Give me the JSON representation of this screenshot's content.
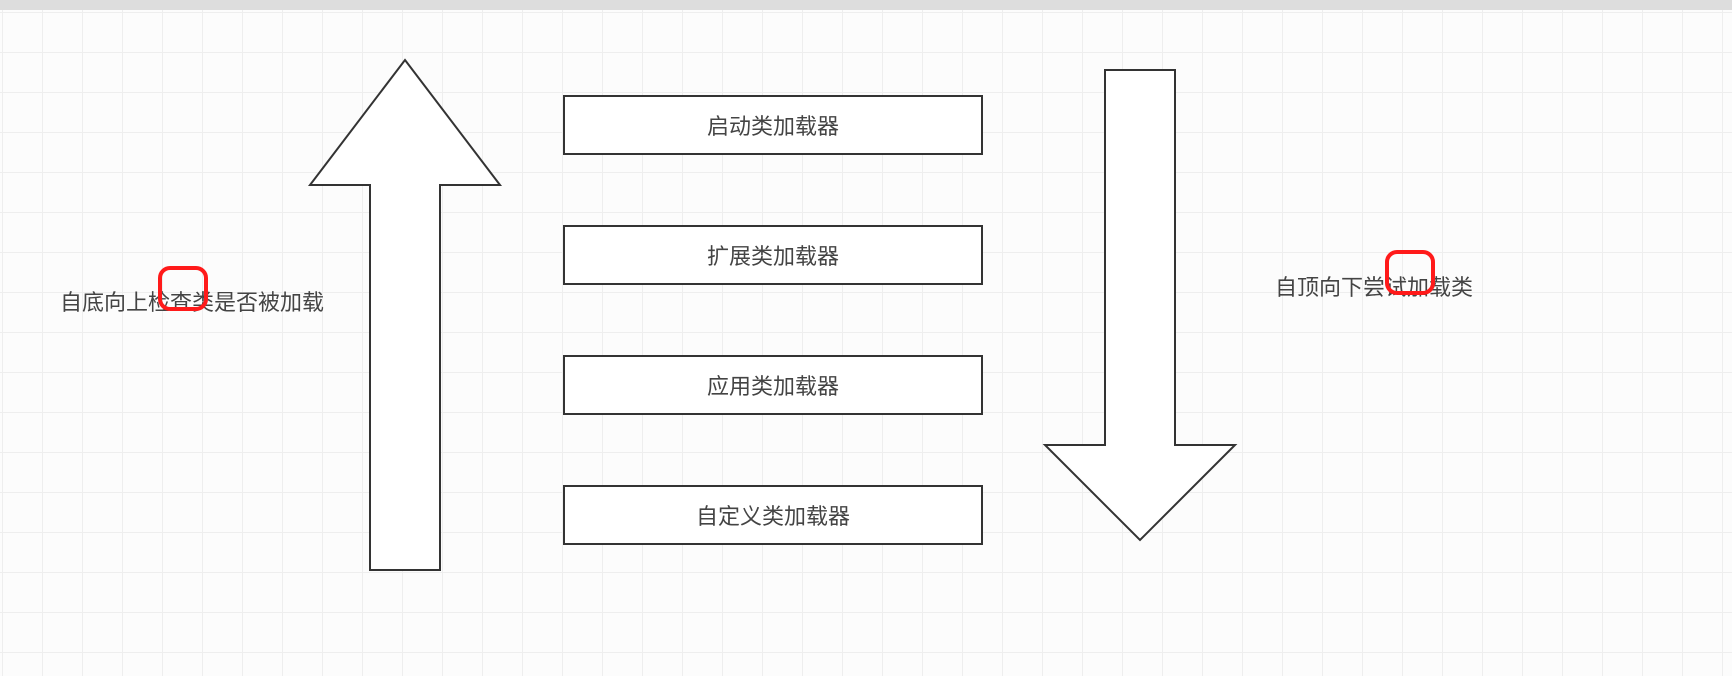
{
  "leftLabel": "自底向上检查类是否被加载",
  "rightLabel": "自顶向下尝试加载类",
  "loaders": {
    "bootstrap": "启动类加载器",
    "extension": "扩展类加载器",
    "application": "应用类加载器",
    "custom": "自定义类加载器"
  }
}
